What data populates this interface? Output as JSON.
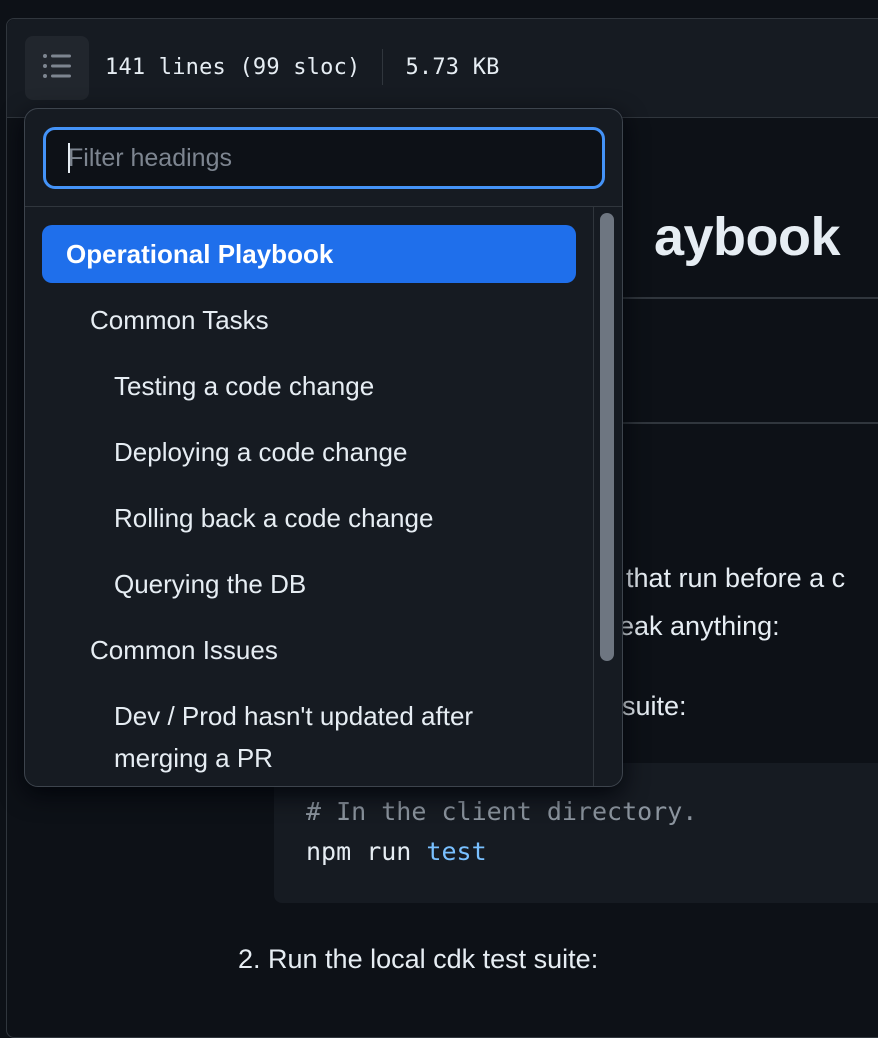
{
  "file_header": {
    "lines_info": "141 lines (99 sloc)",
    "size": "5.73 KB",
    "toc_icon": "list-unordered-icon"
  },
  "article": {
    "title_visible": "aybook",
    "para1_fragment": "that run before a c",
    "para2_fragment": "eak anything:",
    "list_item1_fragment": "suite:",
    "code_comment": "# In the client directory.",
    "code_cmd": "npm run",
    "code_arg": "test",
    "list_item2": "2. Run the local cdk test suite:"
  },
  "toc_popover": {
    "filter_placeholder": "Filter headings",
    "items": [
      {
        "label": "Operational Playbook",
        "level": 1,
        "active": true
      },
      {
        "label": "Common Tasks",
        "level": 2,
        "active": false
      },
      {
        "label": "Testing a code change",
        "level": 3,
        "active": false
      },
      {
        "label": "Deploying a code change",
        "level": 3,
        "active": false
      },
      {
        "label": "Rolling back a code change",
        "level": 3,
        "active": false
      },
      {
        "label": "Querying the DB",
        "level": 3,
        "active": false
      },
      {
        "label": "Common Issues",
        "level": 2,
        "active": false
      },
      {
        "label": "Dev / Prod hasn't updated after merging a PR",
        "level": 3,
        "active": false
      }
    ]
  },
  "colors": {
    "background": "#0d1117",
    "accent": "#1f6feb",
    "focus_ring": "#4493f8",
    "code_keyword": "#79c0ff"
  }
}
